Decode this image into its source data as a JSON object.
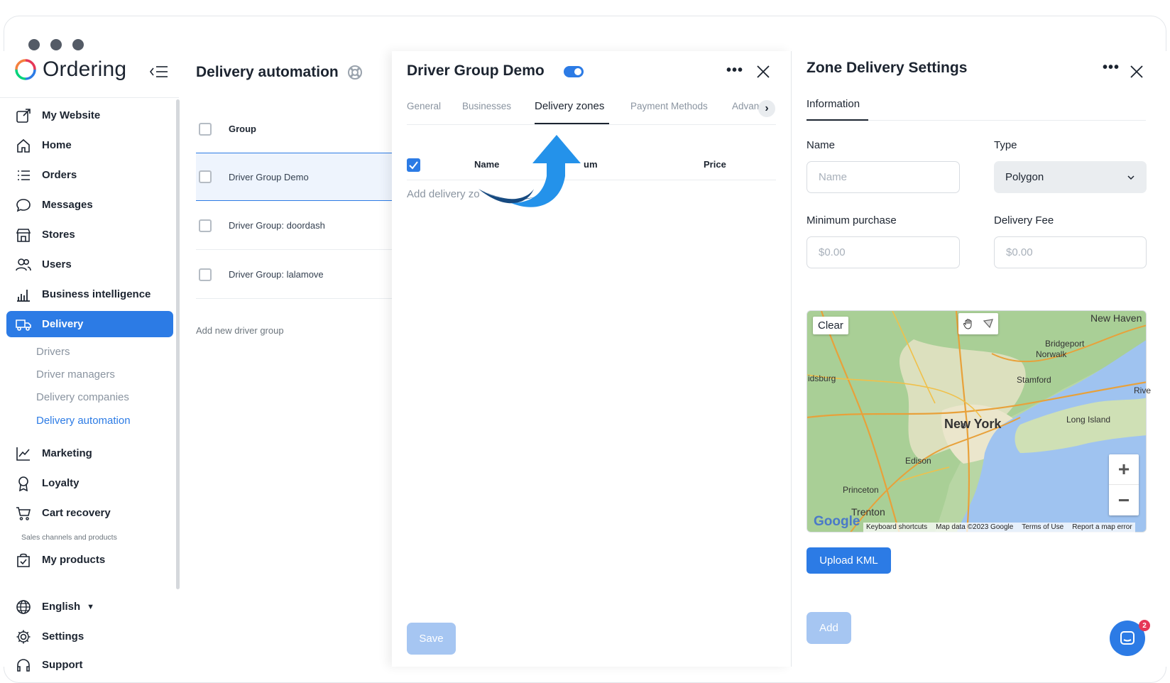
{
  "sidebar": {
    "logo_text": "Ordering",
    "items": [
      {
        "label": "My Website",
        "icon": "external-link-icon"
      },
      {
        "label": "Home",
        "icon": "home-icon"
      },
      {
        "label": "Orders",
        "icon": "list-icon"
      },
      {
        "label": "Messages",
        "icon": "chat-bubble-icon"
      },
      {
        "label": "Stores",
        "icon": "store-icon"
      },
      {
        "label": "Users",
        "icon": "users-icon"
      },
      {
        "label": "Business intelligence",
        "icon": "bar-chart-icon"
      },
      {
        "label": "Delivery",
        "icon": "truck-icon",
        "active": true
      },
      {
        "label": "Marketing",
        "icon": "line-chart-icon"
      },
      {
        "label": "Loyalty",
        "icon": "award-icon"
      },
      {
        "label": "Cart recovery",
        "icon": "cart-icon"
      },
      {
        "label": "My products",
        "icon": "bag-check-icon"
      },
      {
        "label": "English",
        "icon": "globe-icon"
      },
      {
        "label": "Settings",
        "icon": "gear-icon"
      },
      {
        "label": "Support",
        "icon": "headset-icon"
      }
    ],
    "delivery_sub": [
      "Drivers",
      "Driver managers",
      "Delivery companies",
      "Delivery automation"
    ],
    "section_label": "Sales channels and products",
    "english_caret": "▼"
  },
  "list_panel": {
    "title": "Delivery automation",
    "column_header": "Group",
    "rows": [
      "Driver Group Demo",
      "Driver Group: doordash",
      "Driver Group: lalamove"
    ],
    "add_link": "Add new driver group"
  },
  "middle_panel": {
    "title": "Driver Group Demo",
    "toggle_on": true,
    "more": "•••",
    "tabs": [
      "General",
      "Businesses",
      "Delivery zones",
      "Payment Methods",
      "Advan"
    ],
    "active_tab": "Delivery zones",
    "table_headers": {
      "name": "Name",
      "minimum": "um",
      "price": "Price"
    },
    "add_zone": "Add delivery zo",
    "save_label": "Save"
  },
  "right_panel": {
    "title": "Zone Delivery Settings",
    "more": "•••",
    "tab": "Information",
    "name_label": "Name",
    "name_placeholder": "Name",
    "type_label": "Type",
    "type_value": "Polygon",
    "min_purchase_label": "Minimum purchase",
    "min_purchase_placeholder": "$0.00",
    "delivery_fee_label": "Delivery Fee",
    "delivery_fee_placeholder": "$0.00",
    "map": {
      "clear": "Clear",
      "places": [
        "New Haven",
        "Bridgeport",
        "Norwalk",
        "Stamford",
        "idsburg",
        "Rive",
        "New York",
        "Long Island",
        "Edison",
        "Princeton",
        "Trenton"
      ],
      "google": "Google",
      "footer": [
        "Keyboard shortcuts",
        "Map data ©2023 Google",
        "Terms of Use",
        "Report a map error"
      ],
      "zoom_in": "+",
      "zoom_out": "−"
    },
    "upload_label": "Upload KML",
    "add_label": "Add",
    "chat_badge": "2"
  },
  "colors": {
    "accent": "#2c7be5",
    "text": "#1c2430",
    "muted": "#8a94a0"
  }
}
